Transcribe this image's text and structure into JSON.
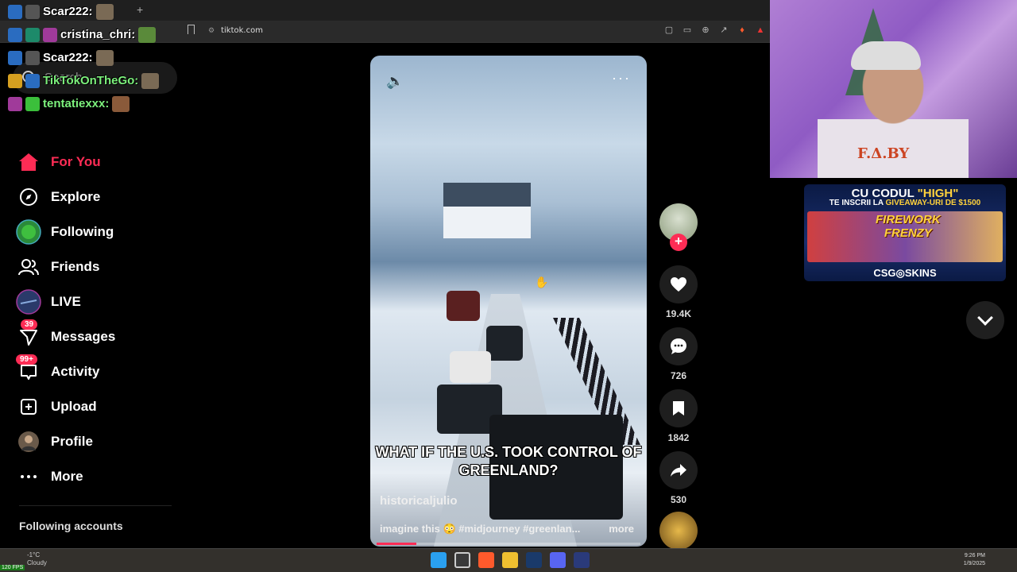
{
  "browser": {
    "url": "tiktok.com",
    "new_tab": "+"
  },
  "chat": [
    {
      "user": "Scar222:",
      "color": "#ffffff"
    },
    {
      "user": "cristina_chri:",
      "color": "#ffffff"
    },
    {
      "user": "Scar222:",
      "color": "#ffffff"
    },
    {
      "user": "TikTokOnTheGo:",
      "color": "#7cf07c"
    },
    {
      "user": "tentatiexxx:",
      "color": "#7cf07c"
    }
  ],
  "search": {
    "placeholder": "Search"
  },
  "nav": [
    {
      "label": "For You",
      "icon": "home-icon",
      "active": true
    },
    {
      "label": "Explore",
      "icon": "compass-icon"
    },
    {
      "label": "Following",
      "icon": "following-avatar-icon"
    },
    {
      "label": "Friends",
      "icon": "friends-icon"
    },
    {
      "label": "LIVE",
      "icon": "live-icon"
    },
    {
      "label": "Messages",
      "icon": "messages-icon",
      "badge": "39"
    },
    {
      "label": "Activity",
      "icon": "activity-icon",
      "badge": "99+"
    },
    {
      "label": "Upload",
      "icon": "upload-icon"
    },
    {
      "label": "Profile",
      "icon": "profile-avatar-icon"
    },
    {
      "label": "More",
      "icon": "more-dots-icon"
    }
  ],
  "following_accounts_label": "Following accounts",
  "video": {
    "caption": "WHAT IF THE U.S. TOOK CONTROL OF GREENLAND?",
    "author": "historicaljulio",
    "description": "imagine this 😳 #midjourney #greenlan...",
    "more_label": "more",
    "progress_fraction": 0.15
  },
  "actions": {
    "likes": "19.4K",
    "comments": "726",
    "saves": "1842",
    "shares": "530"
  },
  "webcam": {
    "shirt_text": "F.Δ.BY"
  },
  "ad": {
    "line1_prefix": "CU CODUL ",
    "line1_code": "\"HIGH\"",
    "line2_prefix": "TE INSCRII LA ",
    "line2_highlight": "GIVEAWAY-URI DE $1500",
    "title_line1": "FIREWORK",
    "title_line2": "FRENZY",
    "brand": "CSG◎SKINS"
  },
  "taskbar": {
    "temperature": "-1°C",
    "weather": "Cloudy",
    "time": "9:26 PM",
    "date": "1/9/2025",
    "fps": "120 FPS"
  },
  "colors": {
    "accent": "#fe2c55",
    "sidebar_bg": "#000000"
  }
}
